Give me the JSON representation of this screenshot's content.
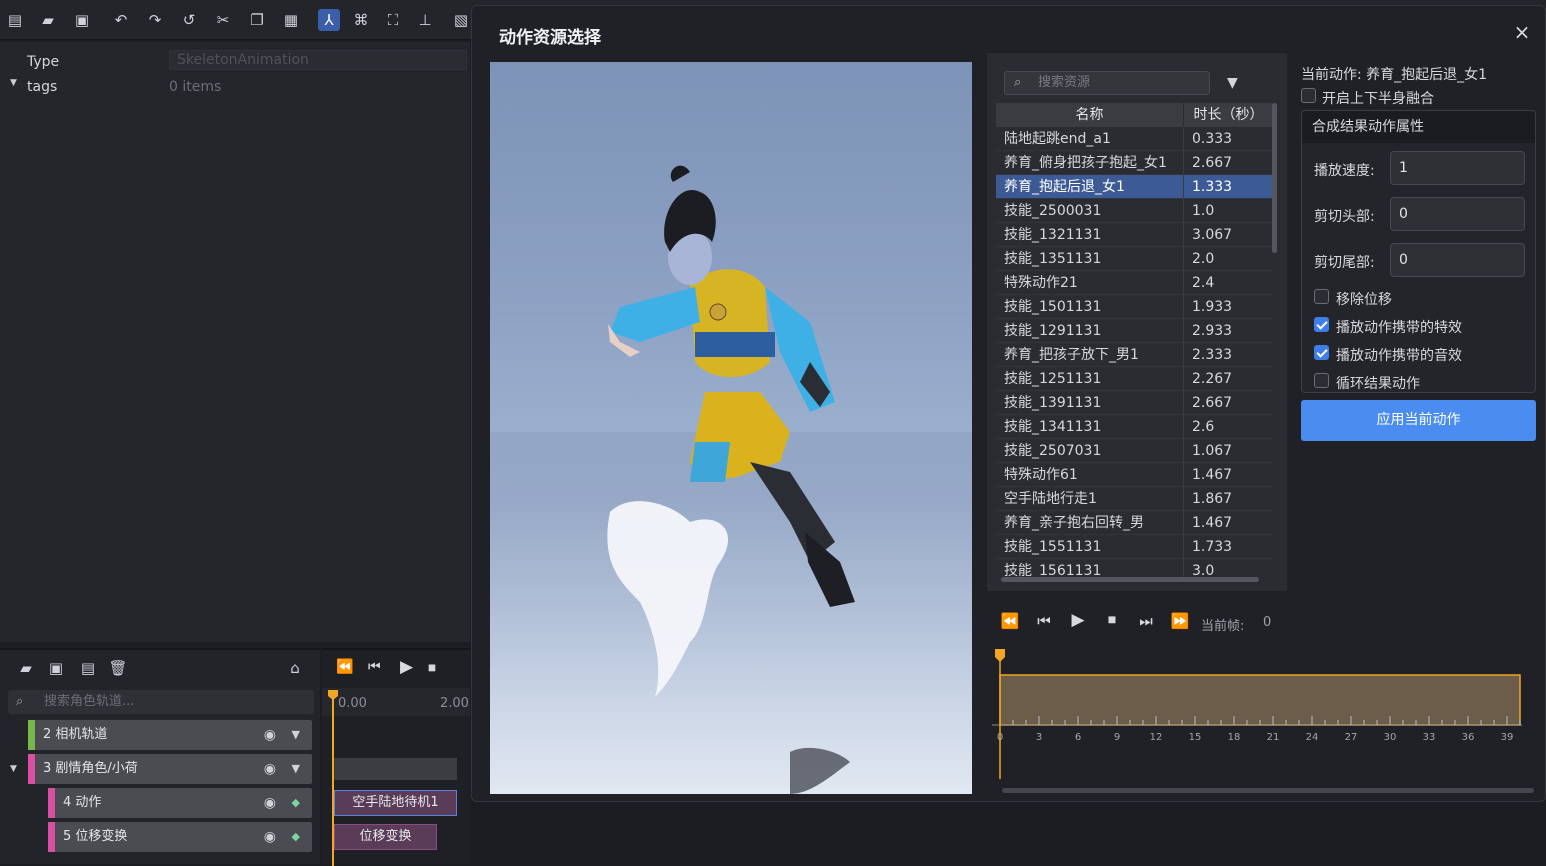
{
  "toolbar": {
    "icons": [
      "new-file-icon",
      "open-folder-icon",
      "save-icon",
      "undo-icon",
      "redo-icon",
      "history-icon",
      "cut-icon",
      "copy-icon",
      "paste-icon",
      "move-tool-icon",
      "link-icon",
      "fullscreen-icon",
      "align-icon",
      "image-icon"
    ]
  },
  "properties": {
    "type_key": "Type",
    "type_value": "SkeletonAnimation",
    "tags_key": "tags",
    "tags_value": "0 items"
  },
  "tracks_panel": {
    "search_placeholder": "搜索角色轨道...",
    "tracks": [
      {
        "label": "2 相机轨道",
        "color": "#77b84a"
      },
      {
        "label": "3 剧情角色/小荷",
        "color": "#d94fa1"
      },
      {
        "label": "4 动作",
        "color": "#d94fa1"
      },
      {
        "label": "5 位移变换",
        "color": "#d94fa1"
      }
    ]
  },
  "timeline": {
    "ticks": [
      "0.00",
      "2.00"
    ],
    "clips": [
      "空手陆地待机1",
      "位移变换"
    ]
  },
  "modal": {
    "title": "动作资源选择",
    "close": "×",
    "search_placeholder": "搜索资源",
    "columns": {
      "name": "名称",
      "duration": "时长（秒）"
    },
    "rows": [
      {
        "name": "陆地起跳end_a1",
        "duration": "0.333"
      },
      {
        "name": "养育_俯身把孩子抱起_女1",
        "duration": "2.667"
      },
      {
        "name": "养育_抱起后退_女1",
        "duration": "1.333",
        "selected": true
      },
      {
        "name": "技能_2500031",
        "duration": "1.0"
      },
      {
        "name": "技能_1321131",
        "duration": "3.067"
      },
      {
        "name": "技能_1351131",
        "duration": "2.0"
      },
      {
        "name": "特殊动作21",
        "duration": "2.4"
      },
      {
        "name": "技能_1501131",
        "duration": "1.933"
      },
      {
        "name": "技能_1291131",
        "duration": "2.933"
      },
      {
        "name": "养育_把孩子放下_男1",
        "duration": "2.333"
      },
      {
        "name": "技能_1251131",
        "duration": "2.267"
      },
      {
        "name": "技能_1391131",
        "duration": "2.667"
      },
      {
        "name": "技能_1341131",
        "duration": "2.6"
      },
      {
        "name": "技能_2507031",
        "duration": "1.067"
      },
      {
        "name": "特殊动作61",
        "duration": "1.467"
      },
      {
        "name": "空手陆地行走1",
        "duration": "1.867"
      },
      {
        "name": "养育_亲子抱右回转_男",
        "duration": "1.467"
      },
      {
        "name": "技能_1551131",
        "duration": "1.733"
      },
      {
        "name": "技能_1561131",
        "duration": "3.0"
      }
    ],
    "current_action_label": "当前动作: 养育_抱起后退_女1",
    "blend_label": "开启上下半身融合",
    "blend_checked": false,
    "group_title": "合成结果动作属性",
    "speed_label": "播放速度:",
    "speed_value": "1",
    "cut_head_label": "剪切头部:",
    "cut_head_value": "0",
    "cut_tail_label": "剪切尾部:",
    "cut_tail_value": "0",
    "options": [
      {
        "label": "移除位移",
        "checked": false
      },
      {
        "label": "播放动作携带的特效",
        "checked": true
      },
      {
        "label": "播放动作携带的音效",
        "checked": true
      },
      {
        "label": "循环结果动作",
        "checked": false
      }
    ],
    "apply_label": "应用当前动作",
    "player": {
      "frame_label": "当前帧:",
      "frame_value": "0",
      "ruler_ticks": [
        "0",
        "3",
        "6",
        "9",
        "12",
        "15",
        "18",
        "21",
        "24",
        "27",
        "30",
        "33",
        "36",
        "39"
      ]
    }
  },
  "colors": {
    "accent": "#4a8cf0",
    "selection": "#3b5a96",
    "timeline_range": "#6b5d4a",
    "playhead": "#f2a623"
  }
}
